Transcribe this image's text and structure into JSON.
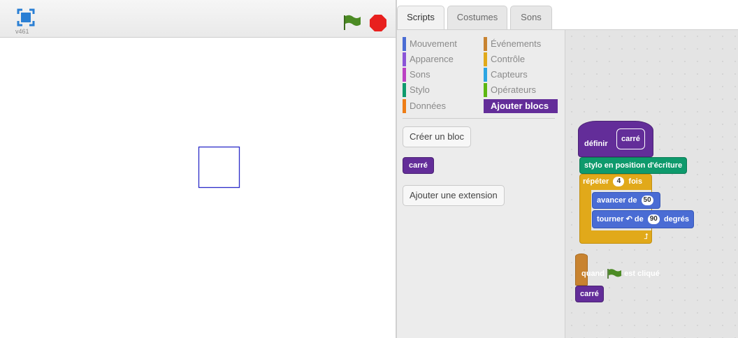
{
  "stage": {
    "version": "v461",
    "pen_square_color": "#2b2bc8"
  },
  "tabs": [
    {
      "label": "Scripts",
      "active": true
    },
    {
      "label": "Costumes",
      "active": false
    },
    {
      "label": "Sons",
      "active": false
    }
  ],
  "categories": [
    {
      "label": "Mouvement",
      "color": "#4a6cd4"
    },
    {
      "label": "Apparence",
      "color": "#8a55d7"
    },
    {
      "label": "Sons",
      "color": "#bb42c3"
    },
    {
      "label": "Stylo",
      "color": "#0e9a6c"
    },
    {
      "label": "Données",
      "color": "#ee7d16"
    },
    {
      "label": "Événements",
      "color": "#c88330"
    },
    {
      "label": "Contrôle",
      "color": "#e1a91a"
    },
    {
      "label": "Capteurs",
      "color": "#2ca5e2"
    },
    {
      "label": "Opérateurs",
      "color": "#5cb712"
    },
    {
      "label": "Ajouter blocs",
      "color": "#632d99",
      "selected": true
    }
  ],
  "palette": {
    "make_block": "Créer un bloc",
    "custom_block": "carré",
    "add_extension": "Ajouter une extension"
  },
  "scripts": {
    "define_label": "définir",
    "define_name": "carré",
    "pen_down": "stylo en position d'écriture",
    "repeat_label": "répéter",
    "repeat_count": "4",
    "repeat_suffix": "fois",
    "move_label": "avancer de",
    "move_steps": "50",
    "turn_label": "tourner",
    "turn_of": "de",
    "turn_degrees": "90",
    "turn_unit": "degrés",
    "when_label": "quand",
    "clicked_label": "est cliqué",
    "call_block": "carré"
  }
}
